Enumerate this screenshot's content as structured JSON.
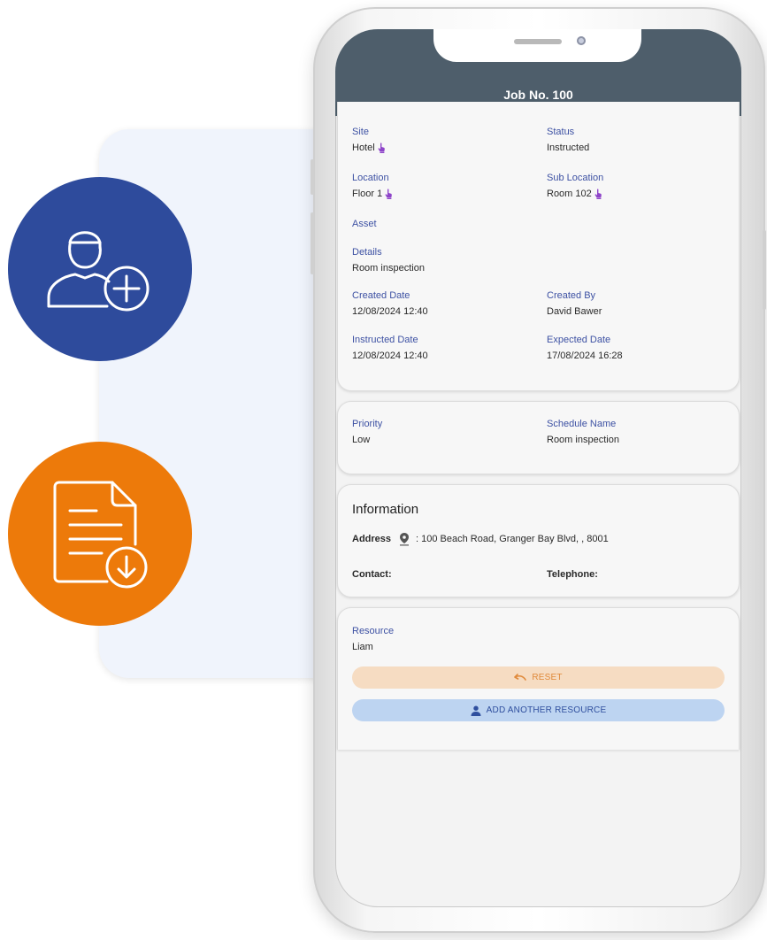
{
  "job": {
    "title": "Job No. 100"
  },
  "details": {
    "site_label": "Site",
    "site_value": "Hotel",
    "status_label": "Status",
    "status_value": "Instructed",
    "location_label": "Location",
    "location_value": "Floor 1",
    "sublocation_label": "Sub Location",
    "sublocation_value": "Room 102",
    "asset_label": "Asset",
    "details_label": "Details",
    "details_value": "Room inspection",
    "created_date_label": "Created Date",
    "created_date_value": "12/08/2024 12:40",
    "created_by_label": "Created By",
    "created_by_value": "David Bawer",
    "instructed_date_label": "Instructed Date",
    "instructed_date_value": "12/08/2024 12:40",
    "expected_date_label": "Expected Date",
    "expected_date_value": "17/08/2024 16:28"
  },
  "priority": {
    "priority_label": "Priority",
    "priority_value": "Low",
    "schedule_label": "Schedule Name",
    "schedule_value": "Room inspection"
  },
  "information": {
    "title": "Information",
    "address_label": "Address",
    "address_value": ": 100 Beach Road, Granger Bay Blvd, , 8001",
    "contact_label": "Contact:",
    "telephone_label": "Telephone:"
  },
  "resource": {
    "label": "Resource",
    "value": "Liam",
    "reset_label": "RESET",
    "add_label": "ADD ANOTHER RESOURCE"
  },
  "icons": {
    "add_user": "add-user-icon",
    "document_download": "document-download-icon",
    "tap": "tap-hand-icon",
    "location_pin": "location-pin-icon",
    "undo": "undo-icon",
    "person": "person-icon"
  },
  "colors": {
    "header": "#4e5e6b",
    "label": "#3d51a3",
    "blue_circle": "#2e4b9c",
    "orange_circle": "#ed7a0a",
    "reset_bg": "#f6dcc2",
    "add_bg": "#bdd4f1"
  }
}
